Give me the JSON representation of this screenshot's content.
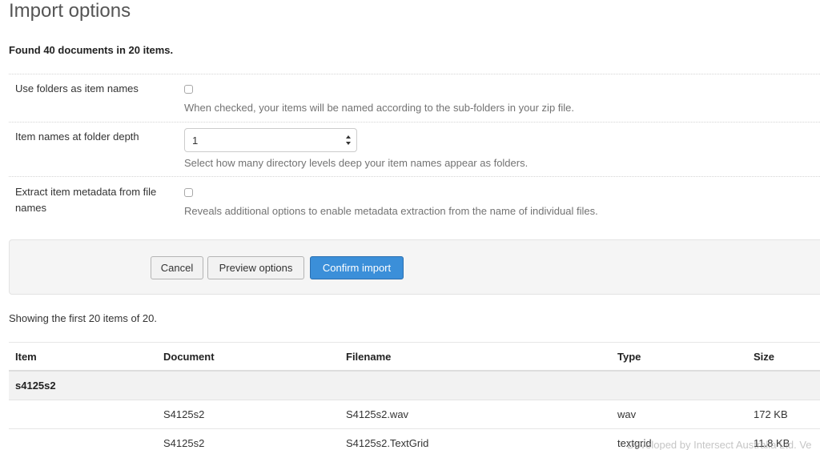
{
  "page": {
    "title": "Import options",
    "found_text": "Found 40 documents in 20 items."
  },
  "options": {
    "use_folders": {
      "label": "Use folders as item names",
      "help": "When checked, your items will be named according to the sub-folders in your zip file.",
      "checked": false
    },
    "folder_depth": {
      "label": "Item names at folder depth",
      "value": "1",
      "help": "Select how many directory levels deep your item names appear as folders."
    },
    "extract_metadata": {
      "label": "Extract item metadata from file names",
      "help": "Reveals additional options to enable metadata extraction from the name of individual files.",
      "checked": false
    }
  },
  "actions": {
    "cancel_label": "Cancel",
    "preview_label": "Preview options",
    "confirm_label": "Confirm import"
  },
  "listing": {
    "showing_text": "Showing the first 20 items of 20."
  },
  "table": {
    "headers": {
      "item": "Item",
      "document": "Document",
      "filename": "Filename",
      "type": "Type",
      "size": "Size"
    },
    "groups": [
      {
        "item": "s4125s2",
        "rows": [
          {
            "document": "S4125s2",
            "filename": "S4125s2.wav",
            "type": "wav",
            "size": "172 KB"
          },
          {
            "document": "S4125s2",
            "filename": "S4125s2.TextGrid",
            "type": "textgrid",
            "size": "11.8 KB"
          }
        ]
      }
    ]
  },
  "footer": {
    "credit": "Developed by Intersect Australia Ltd. Ve"
  },
  "colors": {
    "primary": "#3b8fd9",
    "panel_bg": "#f5f5f5",
    "group_bg": "#f2f2f2"
  }
}
